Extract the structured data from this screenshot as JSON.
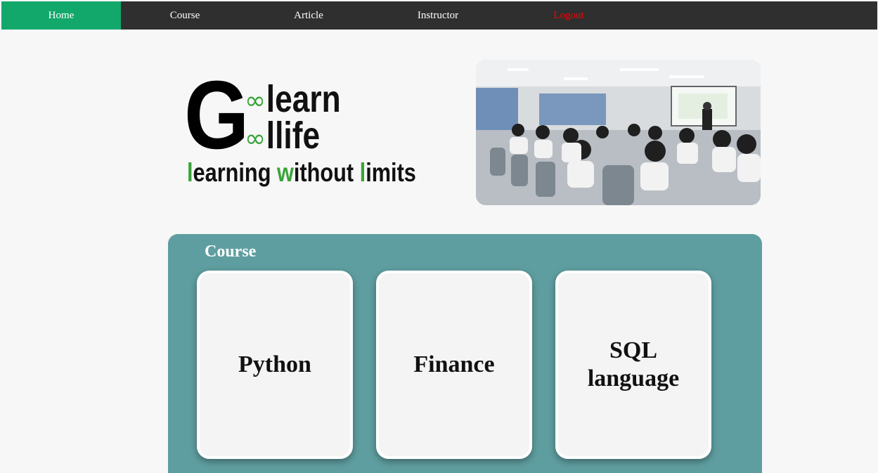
{
  "nav": {
    "items": [
      {
        "label": "Home",
        "active": true
      },
      {
        "label": "Course"
      },
      {
        "label": "Article"
      },
      {
        "label": "Instructor"
      },
      {
        "label": "Logout",
        "color": "#ff0000"
      }
    ],
    "background": "#2f2f2f",
    "active_color": "#12a86b"
  },
  "logo": {
    "letter": "G",
    "line1": "learn",
    "line2": "llife",
    "tagline_parts": [
      "l",
      "earning ",
      "w",
      "ithout ",
      "l",
      "imits"
    ],
    "accent": "#3aa33a"
  },
  "hero_image": {
    "description_icon": "classroom-photo"
  },
  "courses": {
    "heading": "Course",
    "panel_color": "#5f9ea0",
    "items": [
      {
        "label": "Python"
      },
      {
        "label": "Finance"
      },
      {
        "label": "SQL language"
      }
    ]
  }
}
